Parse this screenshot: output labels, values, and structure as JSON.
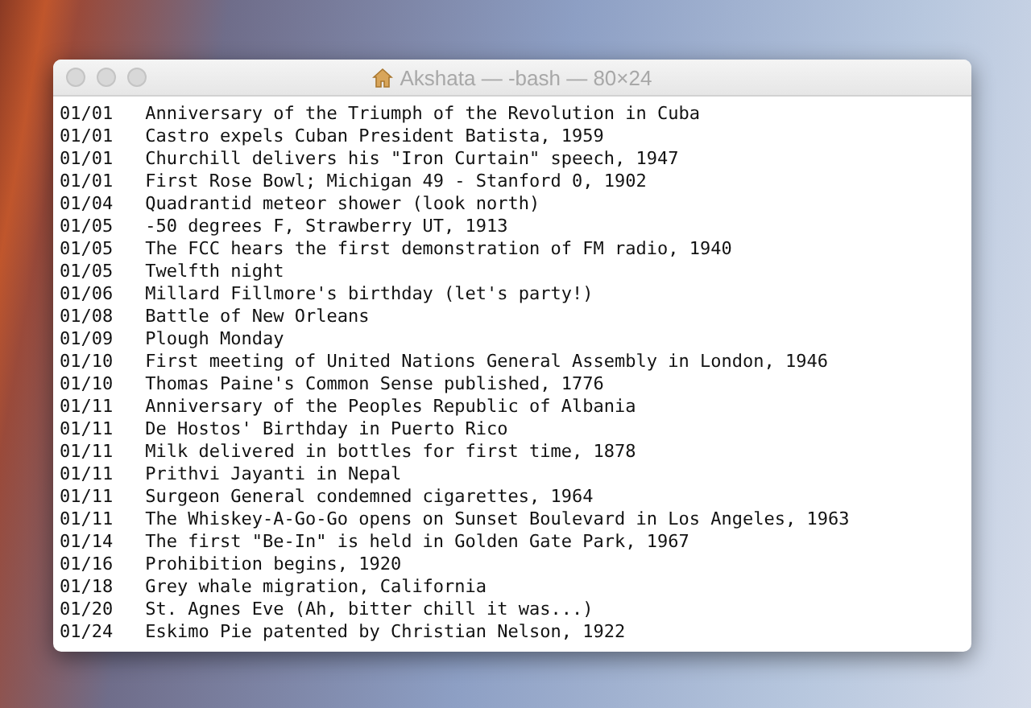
{
  "window": {
    "title": "Akshata — -bash — 80×24"
  },
  "terminal": {
    "lines": [
      {
        "date": "01/01",
        "text": "Anniversary of the Triumph of the Revolution in Cuba"
      },
      {
        "date": "01/01",
        "text": "Castro expels Cuban President Batista, 1959"
      },
      {
        "date": "01/01",
        "text": "Churchill delivers his \"Iron Curtain\" speech, 1947"
      },
      {
        "date": "01/01",
        "text": "First Rose Bowl; Michigan 49 - Stanford 0, 1902"
      },
      {
        "date": "01/04",
        "text": "Quadrantid meteor shower (look north)"
      },
      {
        "date": "01/05",
        "text": "-50 degrees F, Strawberry UT, 1913"
      },
      {
        "date": "01/05",
        "text": "The FCC hears the first demonstration of FM radio, 1940"
      },
      {
        "date": "01/05",
        "text": "Twelfth night"
      },
      {
        "date": "01/06",
        "text": "Millard Fillmore's birthday (let's party!)"
      },
      {
        "date": "01/08",
        "text": "Battle of New Orleans"
      },
      {
        "date": "01/09",
        "text": "Plough Monday"
      },
      {
        "date": "01/10",
        "text": "First meeting of United Nations General Assembly in London, 1946"
      },
      {
        "date": "01/10",
        "text": "Thomas Paine's Common Sense published, 1776"
      },
      {
        "date": "01/11",
        "text": "Anniversary of the Peoples Republic of Albania"
      },
      {
        "date": "01/11",
        "text": "De Hostos' Birthday in Puerto Rico"
      },
      {
        "date": "01/11",
        "text": "Milk delivered in bottles for first time, 1878"
      },
      {
        "date": "01/11",
        "text": "Prithvi Jayanti in Nepal"
      },
      {
        "date": "01/11",
        "text": "Surgeon General condemned cigarettes, 1964"
      },
      {
        "date": "01/11",
        "text": "The Whiskey-A-Go-Go opens on Sunset Boulevard in Los Angeles, 1963"
      },
      {
        "date": "01/14",
        "text": "The first \"Be-In\" is held in Golden Gate Park, 1967"
      },
      {
        "date": "01/16",
        "text": "Prohibition begins, 1920"
      },
      {
        "date": "01/18",
        "text": "Grey whale migration, California"
      },
      {
        "date": "01/20",
        "text": "St. Agnes Eve (Ah, bitter chill it was...)"
      },
      {
        "date": "01/24",
        "text": "Eskimo Pie patented by Christian Nelson, 1922"
      }
    ]
  }
}
